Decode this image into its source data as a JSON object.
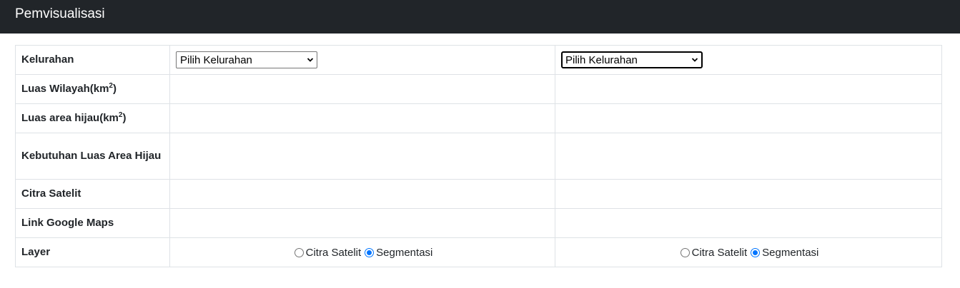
{
  "navbar": {
    "brand": "Pemvisualisasi"
  },
  "table": {
    "rows": {
      "kelurahan": {
        "label": "Kelurahan"
      },
      "luas_wilayah": {
        "label_prefix": "Luas Wilayah(km",
        "sup": "2",
        "label_suffix": ")"
      },
      "luas_hijau": {
        "label_prefix": "Luas area hijau(km",
        "sup": "2",
        "label_suffix": ")"
      },
      "kebutuhan": {
        "label": "Kebutuhan Luas Area Hijau"
      },
      "citra": {
        "label": "Citra Satelit"
      },
      "link": {
        "label": "Link Google Maps"
      },
      "layer": {
        "label": "Layer"
      }
    },
    "select": {
      "selected_value": "Pilih Kelurahan"
    },
    "layer_options": {
      "option_a": "Citra Satelit",
      "option_b": "Segmentasi",
      "selected": "Segmentasi"
    }
  },
  "colors": {
    "navbar_bg": "#212529",
    "border": "#dee2e6",
    "radio_accent": "#0075ff"
  }
}
